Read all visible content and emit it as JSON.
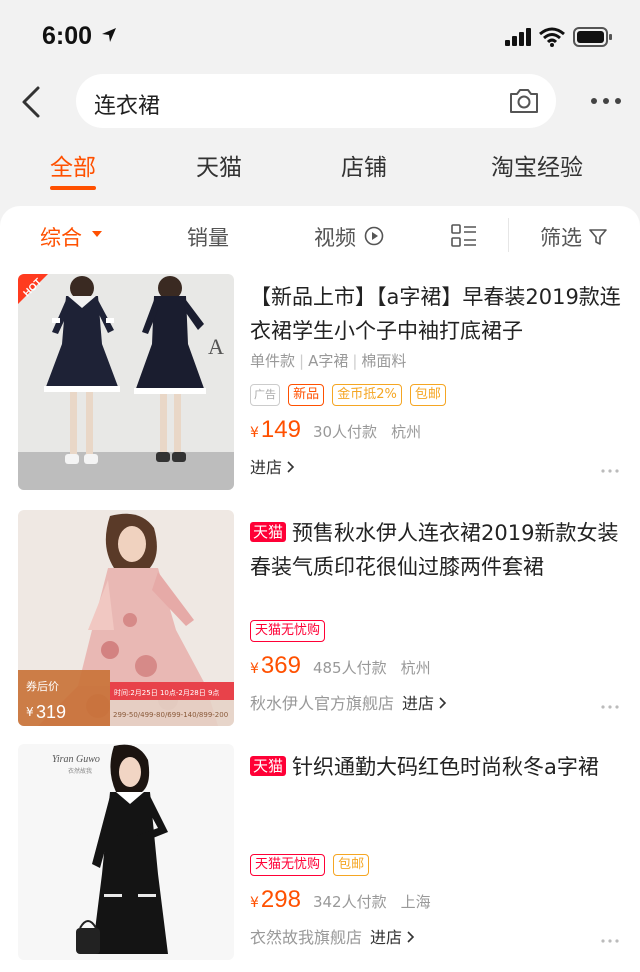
{
  "status_bar": {
    "time": "6:00"
  },
  "search": {
    "query": "连衣裙"
  },
  "tabs": [
    {
      "label": "全部",
      "active": true
    },
    {
      "label": "天猫",
      "active": false
    },
    {
      "label": "店铺",
      "active": false
    },
    {
      "label": "淘宝经验",
      "active": false
    }
  ],
  "sort_bar": {
    "items": [
      "综合",
      "销量",
      "视频",
      "筛选"
    ],
    "active": "综合"
  },
  "products": [
    {
      "title": "【新品上市】【a字裙】早春装2019款连衣裙学生小个子中袖打底裙子",
      "attributes": [
        "单件款",
        "A字裙",
        "棉面料"
      ],
      "ad_label": "广告",
      "badges": [
        "新品",
        "金币抵2%",
        "包邮"
      ],
      "currency": "¥",
      "price": "149",
      "sold": "30人付款",
      "location": "杭州",
      "enter_store": "进店",
      "image_label": "HOT",
      "image_caption": "A"
    },
    {
      "tmall_tag": "天猫",
      "title": "预售秋水伊人连衣裙2019新款女装春装气质印花很仙过膝两件套裙",
      "badges": [
        "天猫无忧购"
      ],
      "currency": "¥",
      "price": "369",
      "sold": "485人付款",
      "location": "杭州",
      "store": "秋水伊人官方旗舰店",
      "enter_store": "进店",
      "promo": {
        "label": "券后价",
        "currency": "¥",
        "price": "319",
        "time": "时间:2月25日 10点-2月28日 9点",
        "deals": "299-50/499-80/699-140/899-200"
      }
    },
    {
      "tmall_tag": "天猫",
      "title": "针织通勤大码红色时尚秋冬a字裙",
      "badges": [
        "天猫无忧购",
        "包邮"
      ],
      "currency": "¥",
      "price": "298",
      "sold": "342人付款",
      "location": "上海",
      "store": "衣然故我旗舰店",
      "enter_store": "进店",
      "image_brand": "Yiran Guwo",
      "image_brand_sub": "衣然故我"
    }
  ],
  "colors": {
    "accent": "#ff5000",
    "tmall_red": "#ff0036",
    "muted": "#999999",
    "background": "#f2f2f2"
  },
  "icons": [
    "location-arrow-icon",
    "signal-icon",
    "wifi-icon",
    "battery-icon",
    "back-arrow-icon",
    "camera-icon",
    "more-icon",
    "caret-down-icon",
    "play-circle-icon",
    "list-view-icon",
    "filter-icon",
    "chevron-right-icon"
  ]
}
